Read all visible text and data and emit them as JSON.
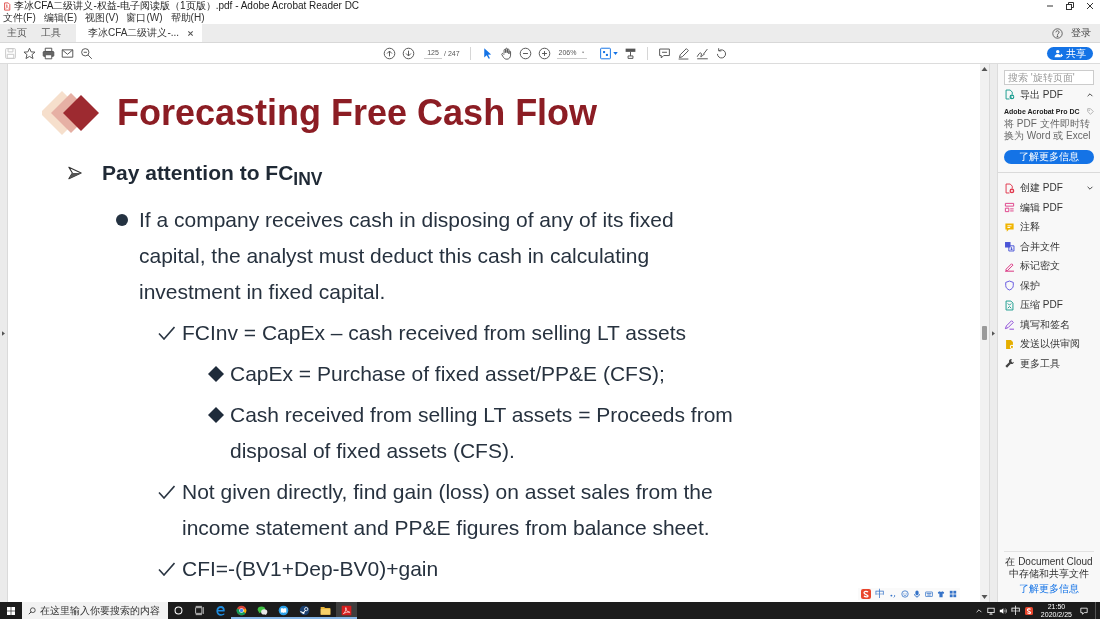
{
  "window": {
    "title": "李冰CFA二级讲义-权益-电子阅读版（1页版）.pdf - Adobe Acrobat Reader DC"
  },
  "menu": [
    "文件(F)",
    "编辑(E)",
    "视图(V)",
    "窗口(W)",
    "帮助(H)"
  ],
  "tabs": [
    {
      "label": "主页",
      "selected": false,
      "closable": false
    },
    {
      "label": "工具",
      "selected": false,
      "closable": false
    },
    {
      "label": "李冰CFA二级讲义-...",
      "selected": true,
      "closable": true
    }
  ],
  "account": {
    "login": "登录"
  },
  "toolbar": {
    "save": {
      "disabled": true
    },
    "page_number": "125",
    "page_total": "/ 247",
    "tools": [
      {
        "kind": "select",
        "selected": true
      },
      {
        "kind": "hand",
        "selected": false
      }
    ],
    "zoom": "206%",
    "share": "共享"
  },
  "slide": {
    "title": "Forecasting Free Cash Flow",
    "outline": [
      {
        "kind": "arrow",
        "text": "Pay attention to FC$_{INV}$",
        "children": [
          {
            "kind": "dot",
            "text": "If a company receives cash in disposing of any of its fixed capital, the analyst must deduct this cash in calculating investment in fixed capital.",
            "children": [
              {
                "kind": "check",
                "text": "FCInv = CapEx – cash received from selling LT assets",
                "children": [
                  {
                    "kind": "diamond",
                    "text": "CapEx = Purchase of fixed asset/PP&E (CFS);"
                  },
                  {
                    "kind": "diamond",
                    "text": "Cash received from selling LT assets = Proceeds from disposal of fixed assets (CFS)."
                  }
                ]
              },
              {
                "kind": "check",
                "text": "Not given directly, find gain (loss) on asset sales from the income statement and PP&E figures from balance sheet."
              },
              {
                "kind": "check",
                "text": "CFI=-(BV1+Dep-BV0)+gain"
              }
            ]
          }
        ]
      }
    ]
  },
  "right_panel": {
    "search_placeholder": "搜索 '旋转页面'",
    "export": {
      "label": "导出 PDF",
      "expanded": true,
      "promo_title": "Adobe Acrobat Pro DC",
      "promo_text": "将 PDF 文件即时转换为 Word 或 Excel",
      "promo_button": "了解更多信息"
    },
    "create": {
      "label": "创建 PDF",
      "expanded": false
    },
    "tools": [
      {
        "kind": "edit",
        "label": "编辑 PDF"
      },
      {
        "kind": "comment",
        "label": "注释"
      },
      {
        "kind": "combine",
        "label": "合并文件"
      },
      {
        "kind": "redact",
        "label": "标记密文"
      },
      {
        "kind": "protect",
        "label": "保护"
      },
      {
        "kind": "compress",
        "label": "压缩 PDF"
      },
      {
        "kind": "sign",
        "label": "填写和签名"
      },
      {
        "kind": "send",
        "label": "发送以供审阅"
      },
      {
        "kind": "more",
        "label": "更多工具"
      }
    ],
    "cloud": {
      "text": "在 Document Cloud 中存储和共享文件",
      "link": "了解更多信息"
    }
  },
  "ime_bar": {
    "mode": "中"
  },
  "taskbar": {
    "search_placeholder": "在这里输入你要搜索的内容",
    "apps": [
      {
        "kind": "edge",
        "running": false,
        "active": false
      },
      {
        "kind": "chrome",
        "running": true,
        "active": false
      },
      {
        "kind": "wechat",
        "running": true,
        "active": false
      },
      {
        "kind": "reader",
        "running": true,
        "active": false
      },
      {
        "kind": "steam",
        "running": true,
        "active": false
      },
      {
        "kind": "folder",
        "running": true,
        "active": false
      },
      {
        "kind": "acrobat",
        "running": true,
        "active": true
      }
    ],
    "ime_mode": "中",
    "time": "21:50",
    "date": "2020/2/25"
  }
}
